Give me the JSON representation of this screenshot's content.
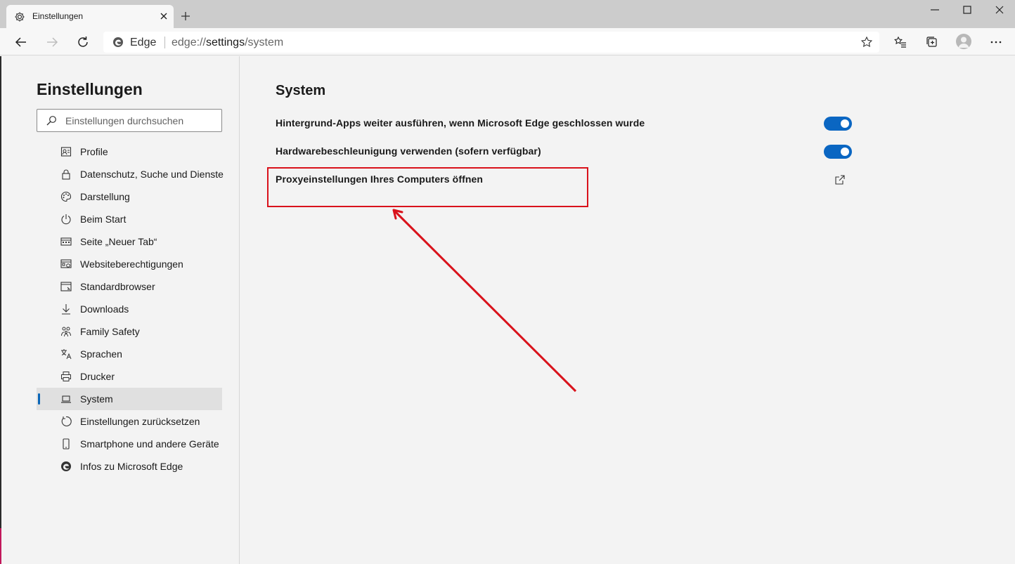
{
  "tab": {
    "title": "Einstellungen",
    "icon": "gear-icon"
  },
  "addressbar": {
    "site_label": "Edge",
    "url_prefix": "edge://",
    "url_host": "settings",
    "url_path": "/system"
  },
  "sidebar": {
    "title": "Einstellungen",
    "search_placeholder": "Einstellungen durchsuchen",
    "items": [
      {
        "label": "Profile",
        "icon": "profile-card-icon"
      },
      {
        "label": "Datenschutz, Suche und Dienste",
        "icon": "lock-icon"
      },
      {
        "label": "Darstellung",
        "icon": "palette-icon"
      },
      {
        "label": "Beim Start",
        "icon": "power-icon"
      },
      {
        "label": "Seite „Neuer Tab“",
        "icon": "new-tab-grid-icon"
      },
      {
        "label": "Websiteberechtigungen",
        "icon": "site-permissions-icon"
      },
      {
        "label": "Standardbrowser",
        "icon": "default-browser-icon"
      },
      {
        "label": "Downloads",
        "icon": "download-arrow-icon"
      },
      {
        "label": "Family Safety",
        "icon": "family-icon"
      },
      {
        "label": "Sprachen",
        "icon": "language-icon"
      },
      {
        "label": "Drucker",
        "icon": "printer-icon"
      },
      {
        "label": "System",
        "icon": "laptop-icon",
        "active": true
      },
      {
        "label": "Einstellungen zurücksetzen",
        "icon": "reset-icon"
      },
      {
        "label": "Smartphone und andere Geräte",
        "icon": "smartphone-icon"
      },
      {
        "label": "Infos zu Microsoft Edge",
        "icon": "edge-logo-icon"
      }
    ]
  },
  "main": {
    "title": "System",
    "settings": [
      {
        "label": "Hintergrund-Apps weiter ausführen, wenn Microsoft Edge geschlossen wurde",
        "control": "toggle",
        "enabled": true
      },
      {
        "label": "Hardwarebeschleunigung verwenden (sofern verfügbar)",
        "control": "toggle",
        "enabled": true
      },
      {
        "label": "Proxyeinstellungen Ihres Computers öffnen",
        "control": "external-link",
        "icon": "external-link-icon"
      }
    ]
  },
  "colors": {
    "accent": "#0a66c2",
    "annotation": "#d9121b",
    "background": "#f3f3f3"
  }
}
